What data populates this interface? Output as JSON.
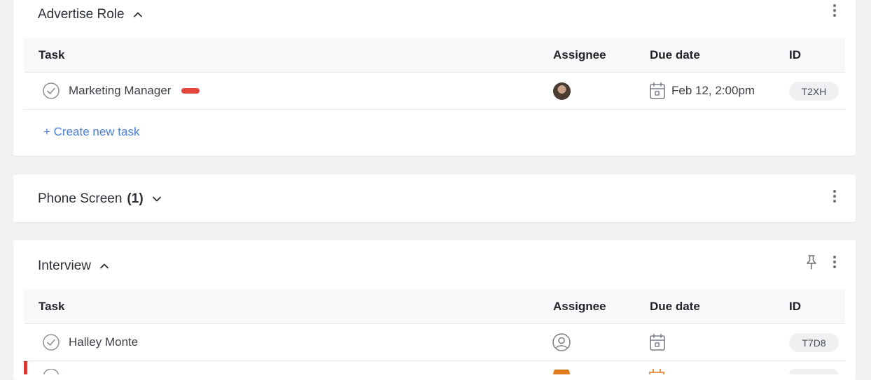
{
  "sections": [
    {
      "title": "Advertise Role",
      "expanded": true,
      "columns": {
        "task": "Task",
        "assignee": "Assignee",
        "due": "Due date",
        "id": "ID"
      },
      "rows": [
        {
          "name": "Marketing Manager",
          "priority": "high",
          "assignee": "photo",
          "due": "Feb 12, 2:00pm",
          "id": "T2XH"
        }
      ],
      "create_label": "+ Create new task"
    },
    {
      "title": "Phone Screen",
      "count": "(1)",
      "expanded": false
    },
    {
      "title": "Interview",
      "expanded": true,
      "columns": {
        "task": "Task",
        "assignee": "Assignee",
        "due": "Due date",
        "id": "ID"
      },
      "rows": [
        {
          "name": "Halley Monte",
          "assignee": "unassigned",
          "due": "",
          "id": "T7D8"
        }
      ]
    }
  ],
  "icons": {
    "complete": "circle-check-icon",
    "expand": "chevron-up-icon",
    "collapse": "chevron-down-icon",
    "menu": "vertical-ellipsis-icon",
    "pin": "pin-icon",
    "calendar": "calendar-icon",
    "user": "user-circle-icon"
  },
  "colors": {
    "page_bg": "#f1f2f4",
    "link": "#4a7fd6",
    "priority_high": "#e5473f",
    "overdue": "#d93a3a",
    "warning": "#e07b1f"
  }
}
